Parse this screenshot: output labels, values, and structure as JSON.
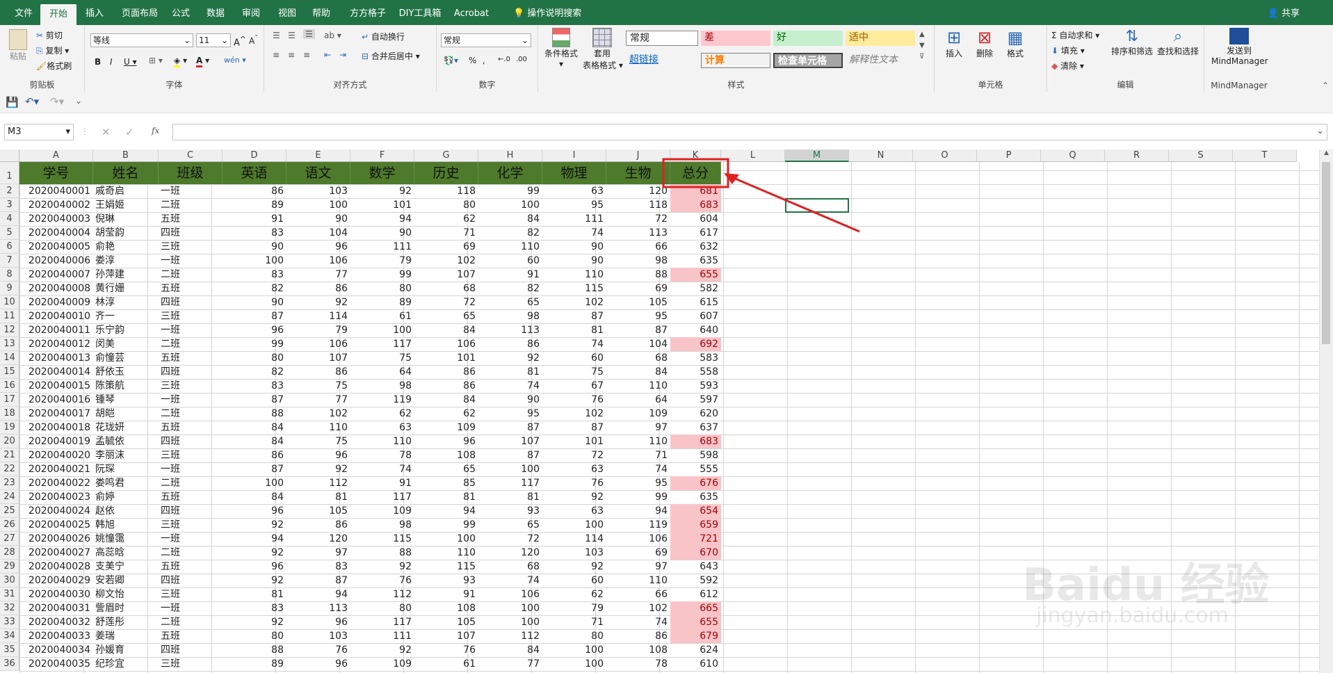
{
  "ribbon_tabs": [
    "文件",
    "开始",
    "插入",
    "页面布局",
    "公式",
    "数据",
    "审阅",
    "视图",
    "帮助",
    "方方格子",
    "DIY工具箱",
    "Acrobat"
  ],
  "active_tab": "开始",
  "tell_me": "操作说明搜索",
  "share": "共享",
  "ribbon": {
    "clipboard": {
      "paste": "粘贴",
      "cut": "剪切",
      "copy": "复制",
      "format_painter": "格式刷",
      "label": "剪贴板"
    },
    "font": {
      "name": "等线",
      "size": "11",
      "label": "字体"
    },
    "alignment": {
      "wrap": "自动换行",
      "merge": "合并后居中",
      "label": "对齐方式"
    },
    "number": {
      "format": "常规",
      "label": "数字"
    },
    "styles": {
      "conditional": "条件格式",
      "table_line1": "套用",
      "table_line2": "表格格式",
      "cells": [
        "常规",
        "差",
        "好",
        "适中",
        "超链接",
        "计算",
        "检查单元格",
        "解释性文本"
      ],
      "label": "样式"
    },
    "cells_group": {
      "insert": "插入",
      "delete": "删除",
      "format": "格式",
      "label": "单元格"
    },
    "editing": {
      "autosum": "自动求和",
      "fill": "填充",
      "clear": "清除",
      "sort": "排序和筛选",
      "find": "查找和选择",
      "label": "编辑"
    },
    "mindmanager": {
      "line1": "发送到",
      "line2": "MindManager",
      "label": "MindManager"
    }
  },
  "name_box": "M3",
  "formula_fx": "fx",
  "columns": [
    "A",
    "B",
    "C",
    "D",
    "E",
    "F",
    "G",
    "H",
    "I",
    "J",
    "K",
    "L",
    "M",
    "N",
    "O",
    "P",
    "Q",
    "R",
    "S",
    "T"
  ],
  "selected_column": "M",
  "selected_cell": "M3",
  "header_row": [
    "学号",
    "姓名",
    "班级",
    "英语",
    "语文",
    "数学",
    "历史",
    "化学",
    "物理",
    "生物",
    "总分"
  ],
  "rows": [
    [
      "2020040001",
      "戚奇启",
      "一班",
      86,
      103,
      92,
      118,
      99,
      63,
      120,
      681
    ],
    [
      "2020040002",
      "王娟姬",
      "二班",
      89,
      100,
      101,
      80,
      100,
      95,
      118,
      683
    ],
    [
      "2020040003",
      "倪琳",
      "五班",
      91,
      90,
      94,
      62,
      84,
      111,
      72,
      604
    ],
    [
      "2020040004",
      "胡莹韵",
      "四班",
      83,
      104,
      90,
      71,
      82,
      74,
      113,
      617
    ],
    [
      "2020040005",
      "俞艳",
      "三班",
      90,
      96,
      111,
      69,
      110,
      90,
      66,
      632
    ],
    [
      "2020040006",
      "娄淳",
      "一班",
      100,
      106,
      79,
      102,
      60,
      90,
      98,
      635
    ],
    [
      "2020040007",
      "孙萍建",
      "二班",
      83,
      77,
      99,
      107,
      91,
      110,
      88,
      655
    ],
    [
      "2020040008",
      "黄行姗",
      "五班",
      82,
      86,
      80,
      68,
      82,
      115,
      69,
      582
    ],
    [
      "2020040009",
      "林淳",
      "四班",
      90,
      92,
      89,
      72,
      65,
      102,
      105,
      615
    ],
    [
      "2020040010",
      "齐一",
      "三班",
      87,
      114,
      61,
      65,
      98,
      87,
      95,
      607
    ],
    [
      "2020040011",
      "乐宁韵",
      "一班",
      96,
      79,
      100,
      84,
      113,
      81,
      87,
      640
    ],
    [
      "2020040012",
      "闵美",
      "二班",
      99,
      106,
      117,
      106,
      86,
      74,
      104,
      692
    ],
    [
      "2020040013",
      "俞憧芸",
      "五班",
      80,
      107,
      75,
      101,
      92,
      60,
      68,
      583
    ],
    [
      "2020040014",
      "舒依玉",
      "四班",
      82,
      86,
      64,
      86,
      81,
      75,
      84,
      558
    ],
    [
      "2020040015",
      "陈策航",
      "三班",
      83,
      75,
      98,
      86,
      74,
      67,
      110,
      593
    ],
    [
      "2020040016",
      "锺琴",
      "一班",
      87,
      77,
      119,
      84,
      90,
      76,
      64,
      597
    ],
    [
      "2020040017",
      "胡皑",
      "二班",
      88,
      102,
      62,
      62,
      95,
      102,
      109,
      620
    ],
    [
      "2020040018",
      "花珑妍",
      "五班",
      84,
      110,
      63,
      109,
      87,
      87,
      97,
      637
    ],
    [
      "2020040019",
      "孟毓依",
      "四班",
      84,
      75,
      110,
      96,
      107,
      101,
      110,
      683
    ],
    [
      "2020040020",
      "李丽沫",
      "三班",
      86,
      96,
      78,
      108,
      87,
      72,
      71,
      598
    ],
    [
      "2020040021",
      "阮琛",
      "一班",
      87,
      92,
      74,
      65,
      100,
      63,
      74,
      555
    ],
    [
      "2020040022",
      "娄鸣君",
      "二班",
      100,
      112,
      91,
      85,
      117,
      76,
      95,
      676
    ],
    [
      "2020040023",
      "俞婷",
      "五班",
      84,
      81,
      117,
      81,
      81,
      92,
      99,
      635
    ],
    [
      "2020040024",
      "赵依",
      "四班",
      96,
      105,
      109,
      94,
      93,
      63,
      94,
      654
    ],
    [
      "2020040025",
      "韩旭",
      "三班",
      92,
      86,
      98,
      99,
      65,
      100,
      119,
      659
    ],
    [
      "2020040026",
      "姚憧霭",
      "一班",
      94,
      120,
      115,
      100,
      72,
      114,
      106,
      721
    ],
    [
      "2020040027",
      "高蕊晗",
      "二班",
      92,
      97,
      88,
      110,
      120,
      103,
      69,
      670
    ],
    [
      "2020040028",
      "支美宁",
      "五班",
      96,
      83,
      92,
      115,
      68,
      92,
      97,
      643
    ],
    [
      "2020040029",
      "安若卿",
      "四班",
      92,
      87,
      76,
      93,
      74,
      60,
      110,
      592
    ],
    [
      "2020040030",
      "柳文怡",
      "三班",
      81,
      94,
      112,
      91,
      106,
      62,
      66,
      612
    ],
    [
      "2020040031",
      "訾眉时",
      "一班",
      83,
      113,
      80,
      108,
      100,
      79,
      102,
      665
    ],
    [
      "2020040032",
      "舒莲彤",
      "二班",
      92,
      96,
      117,
      105,
      100,
      71,
      74,
      655
    ],
    [
      "2020040033",
      "姜瑞",
      "五班",
      80,
      103,
      111,
      107,
      112,
      80,
      86,
      679
    ],
    [
      "2020040034",
      "孙媛育",
      "四班",
      88,
      76,
      92,
      76,
      84,
      100,
      108,
      624
    ],
    [
      "2020040035",
      "纪珍宜",
      "三班",
      89,
      96,
      109,
      61,
      77,
      100,
      78,
      610
    ]
  ],
  "highlight_threshold": 650,
  "colors": {
    "excel_green": "#217346",
    "header_fill": "#4e7a2c",
    "highlight_fill": "#f9c4c8",
    "highlight_text": "#9c0006",
    "annotation_red": "#e02020"
  }
}
